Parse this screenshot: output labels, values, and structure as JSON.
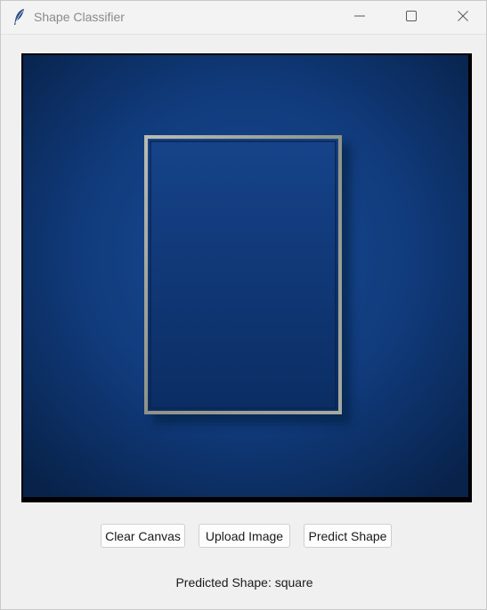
{
  "window": {
    "title": "Shape Classifier",
    "app_icon": "feather-icon",
    "controls": [
      "minimize-icon",
      "maximize-icon",
      "close-icon"
    ]
  },
  "canvas": {
    "content": "uploaded image",
    "background_color": "#0d2f66",
    "frame_color": "#8a8f8c"
  },
  "buttons": {
    "clear_label": "Clear Canvas",
    "upload_label": "Upload Image",
    "predict_label": "Predict Shape"
  },
  "result": {
    "text": "Predicted Shape: square"
  }
}
